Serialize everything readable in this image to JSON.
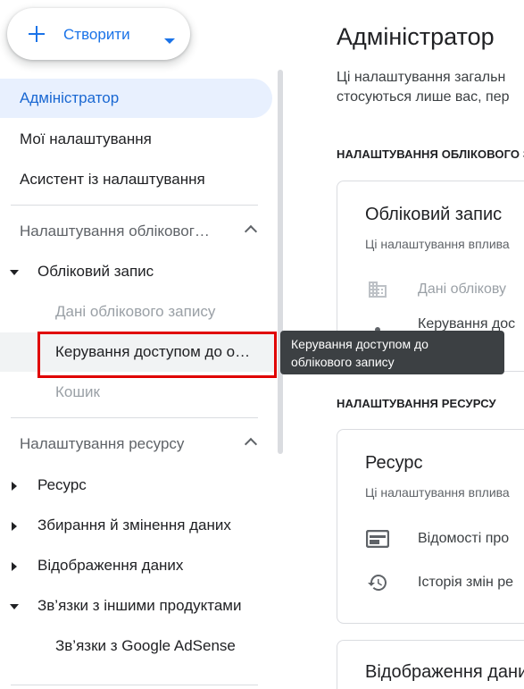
{
  "create": {
    "label": "Створити"
  },
  "sidebar": {
    "active": "Адміністратор",
    "top_items": [
      "Мої налаштування",
      "Асистент із налаштування"
    ],
    "account_section": "Налаштування обліковог…",
    "account_group": "Обліковий запис",
    "account_leaves": [
      "Дані облікового запису",
      "Керування доступом до о…",
      "Кошик"
    ],
    "property_section": "Налаштування ресурсу",
    "property_items": [
      "Ресурс",
      "Збирання й змінення даних",
      "Відображення даних",
      "Зв’язки з іншими продуктами"
    ],
    "links_leaf": "Зв’язки з Google AdSense"
  },
  "tooltip": {
    "line1": "Керування доступом до",
    "line2": "облікового запису"
  },
  "main": {
    "title": "Адміністратор",
    "intro_line1": "Ці налаштування загальн",
    "intro_line2": "стосуються лише вас, пер",
    "account_settings_label": "НАЛАШТУВАННЯ ОБЛІКОВОГО З",
    "account_card": {
      "title": "Обліковий запис",
      "desc": "Ці налаштування вплива",
      "rows": [
        "Дані облікову",
        "Керування дос"
      ]
    },
    "property_settings_label": "НАЛАШТУВАННЯ РЕСУРСУ",
    "property_card": {
      "title": "Ресурс",
      "desc": "Ці налаштування вплива",
      "rows": [
        "Відомості про",
        "Історія змін ре"
      ]
    },
    "display_card": {
      "title": "Відображення дани"
    }
  }
}
